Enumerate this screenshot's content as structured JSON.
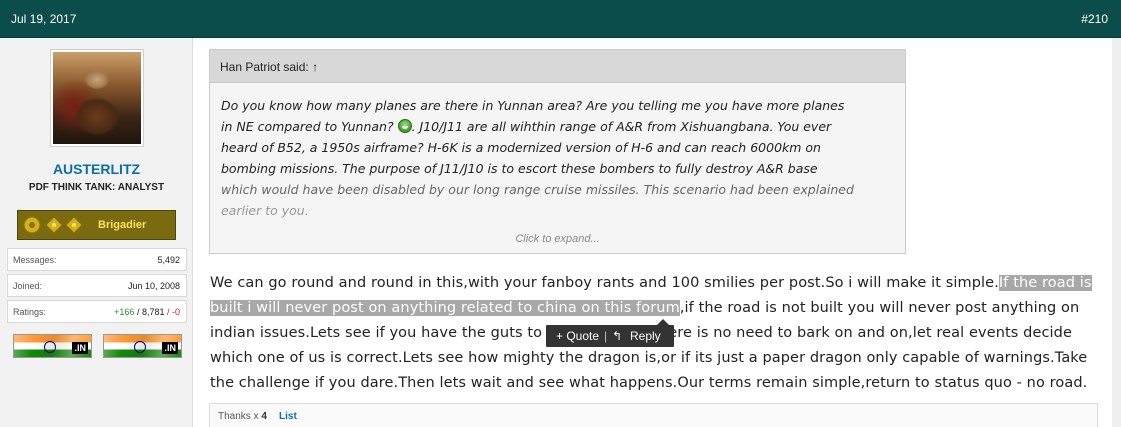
{
  "post": {
    "date": "Jul 19, 2017",
    "number": "#210"
  },
  "user": {
    "name": "AUSTERLITZ",
    "title": "PDF THINK TANK: ANALYST",
    "rank": "Brigadier",
    "stats": {
      "messages_label": "Messages:",
      "messages_value": "5,492",
      "joined_label": "Joined:",
      "joined_value": "Jun 10, 2008",
      "ratings_label": "Ratings:",
      "ratings_positive": "+166",
      "ratings_sep": " / ",
      "ratings_total": "8,781",
      "ratings_negative": " / -0"
    },
    "flags": [
      {
        "tld": ".IN"
      },
      {
        "tld": ".IN"
      }
    ]
  },
  "quote": {
    "author": "Han Patriot said:",
    "arrow": "↑",
    "line1": "Do you know how many planes are there in Yunnan area? Are you telling me you have more planes",
    "line2a": "in NE compared to Yunnan? ",
    "line2b": ". J10/J11 are all wihthin range of A&R from Xishuangbana. You ever",
    "line3": "heard of B52, a 1950s airframe? H-6K is a modernized version of H-6 and can reach 6000km on",
    "line4": "bombing missions. The purpose of J11/J10 is to escort these bombers to fully destroy A&R base",
    "line5": "which would have been disabled by our long range cruise missiles. This scenario had been explained",
    "line6": "earlier to you.",
    "expand": "Click to expand..."
  },
  "message": {
    "part1": "We can go round and round in this,with your fanboy rants and 100 smilies per post.So i will make it simple.",
    "highlight1": "If the road is",
    "highlight2": "built i will never post on anything related to china on this forum",
    "part2": ",if the road is not built you will never post anything on indian issues.Lets see if you have the guts to take the offer.There is no need to bark on and on,let real events decide which one of us is correct.Lets see how mighty the dragon is,or if its just a paper dragon only capable of warnings.Take the challenge if you dare.Then lets wait and see what happens.Our terms remain simple,return to status quo - no road."
  },
  "tooltip": {
    "quote": "+ Quote",
    "sep": "|",
    "reply_icon": "↰",
    "reply": "Reply"
  },
  "likes": {
    "thanks": "Thanks x",
    "count": "4",
    "list": "List"
  }
}
